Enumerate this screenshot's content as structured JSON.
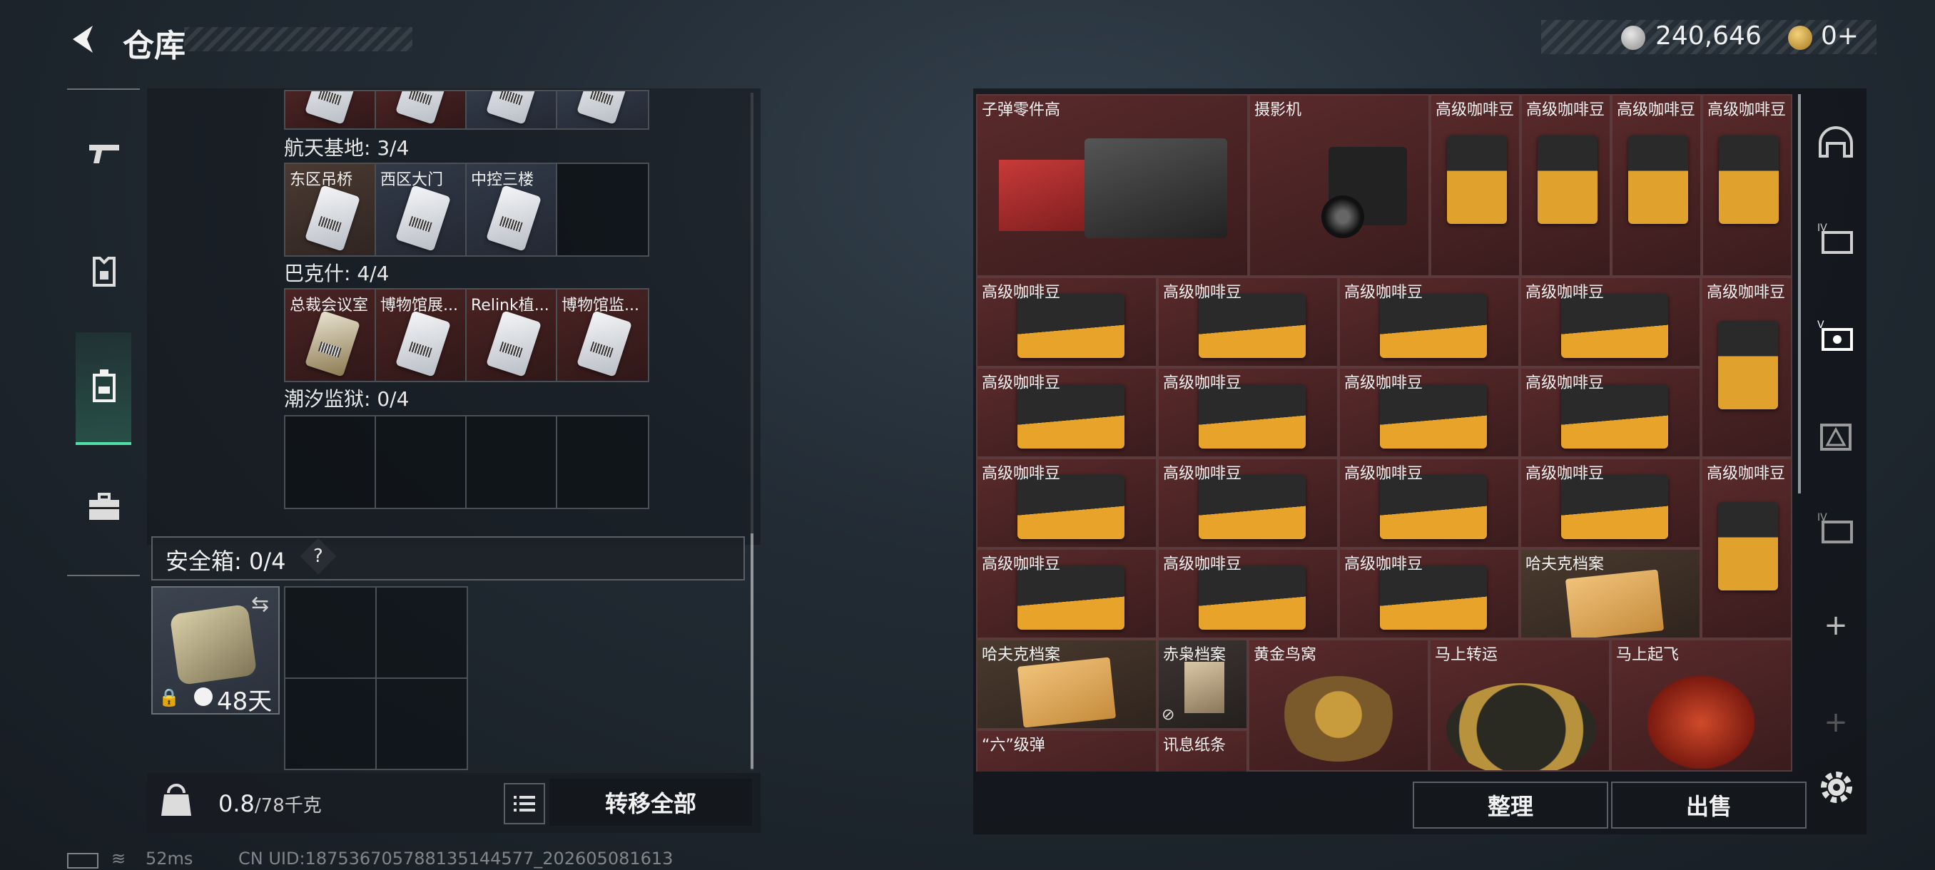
{
  "header": {
    "title": "仓库",
    "currency_1": "240,646",
    "currency_2": "0+"
  },
  "left_nav": {
    "items": [
      {
        "icon": "gun-icon"
      },
      {
        "icon": "armor-icon"
      },
      {
        "icon": "backpack-icon",
        "active": true
      },
      {
        "icon": "toolbox-icon"
      }
    ]
  },
  "keycards": {
    "sections": [
      {
        "label": "航天基地: 3/4",
        "cells": [
          "东区吊桥",
          "西区大门",
          "中控三楼",
          ""
        ]
      },
      {
        "label": "巴克什: 4/4",
        "cells": [
          "总裁会议室",
          "博物馆展...",
          "Relink植...",
          "博物馆监..."
        ]
      },
      {
        "label": "潮汐监狱: 0/4",
        "cells": [
          "",
          "",
          "",
          ""
        ]
      }
    ]
  },
  "safe_box": {
    "title": "安全箱: 0/4",
    "help": "?",
    "duration": "48天"
  },
  "weight": {
    "current": "0.8",
    "max": "/78千克"
  },
  "buttons": {
    "transfer_all": "转移全部",
    "organize": "整理",
    "sell": "出售"
  },
  "status_bar": {
    "ping": "52ms",
    "uid": "CN UID:1875367057881351445​77_202605081613"
  },
  "inventory": {
    "items": [
      {
        "label": "子弹零件高",
        "type": "ammo-crate"
      },
      {
        "label": "摄影机",
        "type": "camera"
      },
      {
        "label": "高级咖啡豆",
        "type": "coffee-bag"
      },
      {
        "label": "高级咖啡豆",
        "type": "coffee-bag"
      },
      {
        "label": "高级咖啡豆",
        "type": "coffee-bag"
      },
      {
        "label": "高级咖啡豆",
        "type": "coffee-bag"
      },
      {
        "label": "高级咖啡豆",
        "type": "coffee-flat"
      },
      {
        "label": "高级咖啡豆",
        "type": "coffee-flat"
      },
      {
        "label": "高级咖啡豆",
        "type": "coffee-flat"
      },
      {
        "label": "高级咖啡豆",
        "type": "coffee-flat"
      },
      {
        "label": "高级咖啡豆",
        "type": "coffee-bag"
      },
      {
        "label": "高级咖啡豆",
        "type": "coffee-flat"
      },
      {
        "label": "高级咖啡豆",
        "type": "coffee-flat"
      },
      {
        "label": "高级咖啡豆",
        "type": "coffee-flat"
      },
      {
        "label": "高级咖啡豆",
        "type": "coffee-flat"
      },
      {
        "label": "高级咖啡豆",
        "type": "coffee-flat"
      },
      {
        "label": "高级咖啡豆",
        "type": "coffee-flat"
      },
      {
        "label": "高级咖啡豆",
        "type": "coffee-flat"
      },
      {
        "label": "高级咖啡豆",
        "type": "coffee-flat"
      },
      {
        "label": "高级咖啡豆",
        "type": "coffee-bag"
      },
      {
        "label": "高级咖啡豆",
        "type": "coffee-flat"
      },
      {
        "label": "高级咖啡豆",
        "type": "coffee-flat"
      },
      {
        "label": "高级咖啡豆",
        "type": "coffee-flat"
      },
      {
        "label": "哈夫克档案",
        "type": "folder"
      },
      {
        "label": "哈夫克档案",
        "type": "folder"
      },
      {
        "label": "赤枭档案",
        "type": "folder"
      },
      {
        "label": "黄金鸟窝",
        "type": "golden-nest"
      },
      {
        "label": "马上转运",
        "type": "horse-dial"
      },
      {
        "label": "马上起飞",
        "type": "red-horse"
      },
      {
        "label": "“六”级弹",
        "type": "ammo"
      },
      {
        "label": "讯息纸条",
        "type": "note"
      }
    ]
  },
  "colors": {
    "item_bg": "#4a2324",
    "accent": "#4fe0a8"
  }
}
